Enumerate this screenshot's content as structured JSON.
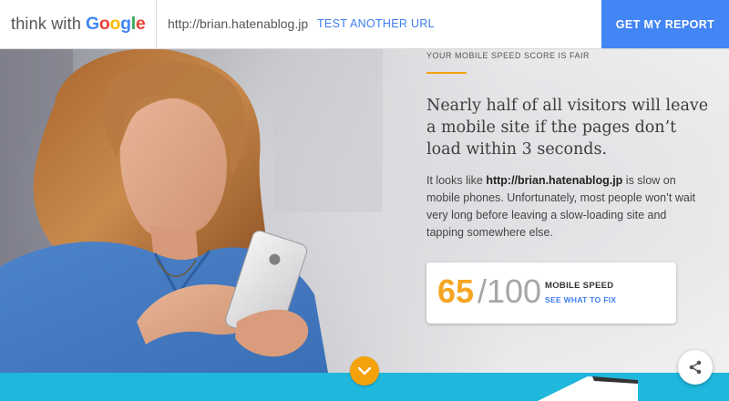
{
  "header": {
    "logo_prefix": "think with",
    "logo_brand": [
      "G",
      "o",
      "o",
      "g",
      "l",
      "e"
    ],
    "url": "http://brian.hatenablog.jp",
    "test_link": "TEST ANOTHER URL",
    "report_button": "GET MY REPORT"
  },
  "result": {
    "score_label": "YOUR MOBILE SPEED SCORE IS FAIR",
    "headline": "Nearly half of all visitors will leave a mobile site if the pages don’t load within 3 seconds.",
    "desc_prefix": "It looks like ",
    "desc_url": "http://brian.hatenablog.jp",
    "desc_suffix": " is slow on mobile phones. Unfortunately, most people won’t wait very long before leaving a slow-loading site and tapping somewhere else.",
    "score": "65",
    "score_max": "/100",
    "metric_label": "MOBILE SPEED",
    "fix_link": "SEE WHAT TO FIX"
  },
  "colors": {
    "brand_blue": "#4285F4",
    "google_red": "#EA4335",
    "google_yellow": "#FBBC05",
    "google_green": "#34A853",
    "score_orange": "#F5A623",
    "link_blue": "#3F7EF3",
    "band_cyan": "#1FB7DC"
  },
  "icons": {
    "scroll": "chevron-down-icon",
    "share": "share-icon"
  }
}
